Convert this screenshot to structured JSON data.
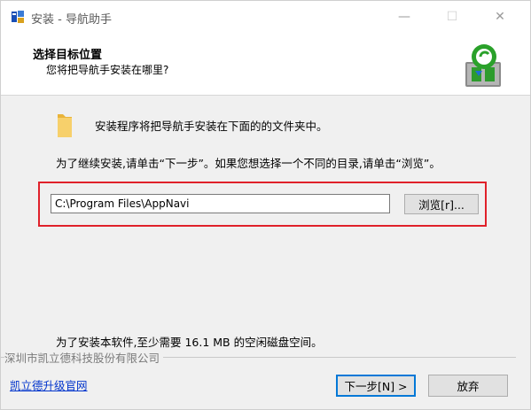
{
  "window": {
    "title": "安装 - 导航助手",
    "controls": {
      "minimize": "—",
      "maximize": "☐",
      "close": "✕"
    }
  },
  "header": {
    "title": "选择目标位置",
    "subtitle": "您将把导航手安装在哪里?",
    "logo_icon": "installer-logo-icon"
  },
  "body": {
    "intro": "安装程序将把导航手安装在下面的的文件夹中。",
    "instruction": "为了继续安装,请单击“下一步”。如果您想选择一个不同的目录,请单击“浏览”。",
    "path_value": "C:\\Program Files\\AppNavi",
    "browse_label": "浏览[r]...",
    "space_required": "为了安装本软件,至少需要 16.1 MB 的空闲磁盘空间。"
  },
  "footer": {
    "company": "深圳市凯立德科技股份有限公司",
    "link": "凯立德升级官网",
    "next_label": "下一步[N] >",
    "cancel_label": "放弃"
  },
  "colors": {
    "highlight_box": "#e0212a",
    "link": "#0033cc",
    "default_button_border": "#0078d7"
  }
}
